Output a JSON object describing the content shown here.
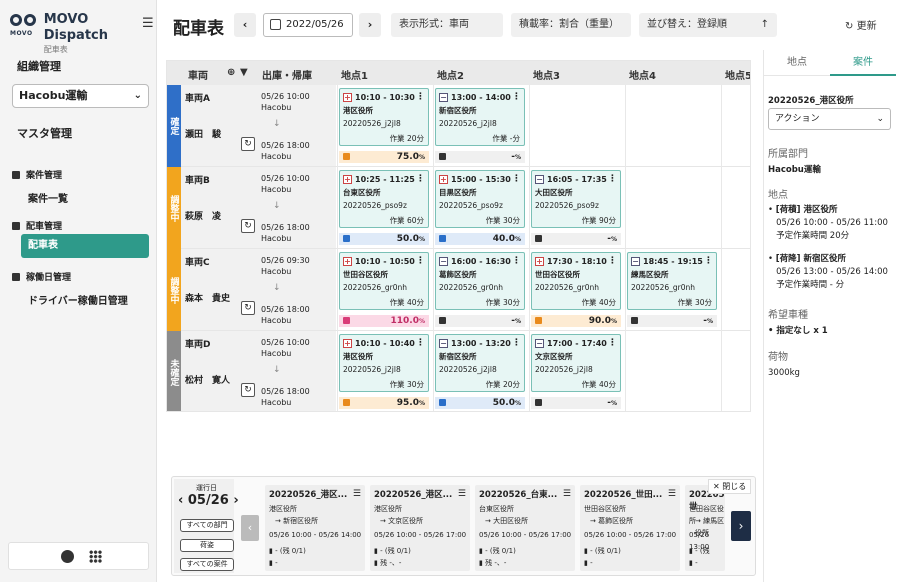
{
  "app": {
    "name": "MOVO Dispatch",
    "subtitle": "配車表",
    "logo_text": "MOVO"
  },
  "sidebar": {
    "org_header": "組織管理",
    "org_select": "Hacobu運輸",
    "master": "マスタ管理",
    "sections": [
      {
        "title": "案件管理",
        "items": [
          "案件一覧"
        ]
      },
      {
        "title": "配車管理",
        "items": [
          "配車表"
        ]
      },
      {
        "title": "稼働日管理",
        "items": [
          "ドライバー稼働日管理"
        ]
      }
    ]
  },
  "toolbar": {
    "title": "配車表",
    "date": "2022/05/26",
    "display": "表示形式：車両",
    "load_rate": "積載率：割合（重量）",
    "sort": "並び替え：登録順",
    "refresh": "更新",
    "prev": "‹",
    "next": "›",
    "sort_arrow": "↑"
  },
  "grid": {
    "headers": {
      "vehicle": "車両",
      "times": "出庫・帰庫",
      "points": [
        "地点1",
        "地点2",
        "地点3",
        "地点4",
        "地点5"
      ]
    },
    "rows": [
      {
        "status": "確定",
        "color": "#2f6fc8",
        "vehicle": "車両A",
        "driver": "瀬田　駿",
        "dep": "05/26 10:00",
        "ret": "05/26 18:00",
        "base": "Hacobu",
        "cards": [
          {
            "type": "pick",
            "time": "10:10 - 10:30",
            "name": "港区役所",
            "id": "20220526_j2jl8",
            "work": "作業 20分"
          },
          {
            "type": "drop",
            "time": "13:00 - 14:00",
            "name": "新宿区役所",
            "id": "20220526_j2jl8",
            "work": "作業 -分"
          }
        ],
        "loads": [
          {
            "value": "75.0",
            "unit": "%",
            "style": "orange"
          },
          {
            "value": "-",
            "unit": "%",
            "style": "grey"
          }
        ]
      },
      {
        "status": "調整中",
        "color": "#f2a51e",
        "vehicle": "車両B",
        "driver": "萩原　凌",
        "dep": "05/26 10:00",
        "ret": "05/26 18:00",
        "base": "Hacobu",
        "cards": [
          {
            "type": "pick",
            "time": "10:25 - 11:25",
            "name": "台東区役所",
            "id": "20220526_pso9z",
            "work": "作業 60分"
          },
          {
            "type": "pick",
            "time": "15:00 - 15:30",
            "name": "目黒区役所",
            "id": "20220526_pso9z",
            "work": "作業 30分"
          },
          {
            "type": "drop",
            "time": "16:05 - 17:35",
            "name": "大田区役所",
            "id": "20220526_pso9z",
            "work": "作業 90分"
          }
        ],
        "loads": [
          {
            "value": "50.0",
            "unit": "%",
            "style": "blue"
          },
          {
            "value": "40.0",
            "unit": "%",
            "style": "blue"
          },
          {
            "value": "-",
            "unit": "%",
            "style": "grey"
          }
        ]
      },
      {
        "status": "調整中",
        "color": "#f2a51e",
        "vehicle": "車両C",
        "driver": "森本　貴史",
        "dep": "05/26 09:30",
        "ret": "05/26 18:00",
        "base": "Hacobu",
        "cards": [
          {
            "type": "pick",
            "time": "10:10 - 10:50",
            "name": "世田谷区役所",
            "id": "20220526_gr0nh",
            "work": "作業 40分"
          },
          {
            "type": "drop",
            "time": "16:00 - 16:30",
            "name": "葛飾区役所",
            "id": "20220526_gr0nh",
            "work": "作業 30分"
          },
          {
            "type": "pick",
            "time": "17:30 - 18:10",
            "name": "世田谷区役所",
            "id": "20220526_gr0nh",
            "work": "作業 40分"
          },
          {
            "type": "drop",
            "time": "18:45 - 19:15",
            "name": "練馬区役所",
            "id": "20220526_gr0nh",
            "work": "作業 30分"
          }
        ],
        "loads": [
          {
            "value": "110.0",
            "unit": "%",
            "style": "pink"
          },
          {
            "value": "-",
            "unit": "%",
            "style": "grey"
          },
          {
            "value": "90.0",
            "unit": "%",
            "style": "orange"
          },
          {
            "value": "-",
            "unit": "%",
            "style": "grey"
          }
        ]
      },
      {
        "status": "未確定",
        "color": "#8c8c8c",
        "vehicle": "車両D",
        "driver": "松村　寛人",
        "dep": "05/26 10:00",
        "ret": "05/26 18:00",
        "base": "Hacobu",
        "cards": [
          {
            "type": "pick",
            "time": "10:10 - 10:40",
            "name": "港区役所",
            "id": "20220526_j2jl8",
            "work": "作業 30分"
          },
          {
            "type": "drop",
            "time": "13:00 - 13:20",
            "name": "新宿区役所",
            "id": "20220526_j2jl8",
            "work": "作業 20分"
          },
          {
            "type": "drop",
            "time": "17:00 - 17:40",
            "name": "文京区役所",
            "id": "20220526_j2jl8",
            "work": "作業 40分"
          }
        ],
        "loads": [
          {
            "value": "95.0",
            "unit": "%",
            "style": "orange"
          },
          {
            "value": "50.0",
            "unit": "%",
            "style": "blue"
          },
          {
            "value": "-",
            "unit": "%",
            "style": "grey"
          }
        ]
      }
    ]
  },
  "bottom": {
    "day_label": "運行日",
    "day_value": "05/26",
    "filters": [
      "すべての部門",
      "荷姿",
      "すべての案件"
    ],
    "close": "閉じる",
    "jobs": [
      {
        "title": "20220526_港区...",
        "from": "港区役所",
        "to": "新宿区役所",
        "time": "05/26 10:00 - 05/26 14:00",
        "vehicle": "- (残 0/1)",
        "cargo": "-"
      },
      {
        "title": "20220526_港区...",
        "from": "港区役所",
        "to": "文京区役所",
        "time": "05/26 10:00 - 05/26 17:00",
        "vehicle": "- (残 0/1)",
        "cargo": "残 -、-"
      },
      {
        "title": "20220526_台東...",
        "from": "台東区役所",
        "to": "大田区役所",
        "time": "05/26 10:00 - 05/26 17:00",
        "vehicle": "- (残 0/1)",
        "cargo": "残 -、-"
      },
      {
        "title": "20220526_世田...",
        "from": "世田谷区役所",
        "to": "葛飾区役所",
        "time": "05/26 10:00 - 05/26 17:00",
        "vehicle": "- (残 0/1)",
        "cargo": "-"
      },
      {
        "title": "20220526_世",
        "from": "世田谷区役所",
        "to": "練馬区役所",
        "time": "05/26 13:00",
        "vehicle": "- (残",
        "cargo": "-"
      }
    ]
  },
  "right": {
    "tabs": [
      "地点",
      "案件"
    ],
    "job_id": "20220526_港区役所",
    "action": "アクション",
    "dept_label": "所属部門",
    "dept": "Hacobu運輸",
    "points_label": "地点",
    "points": [
      {
        "title": "[荷積] 港区役所",
        "time": "05/26 10:00 - 05/26 11:00",
        "work": "予定作業時間 20分"
      },
      {
        "title": "[荷降] 新宿区役所",
        "time": "05/26 13:00 - 05/26 14:00",
        "work": "予定作業時間 - 分"
      }
    ],
    "vehicle_label": "希望車種",
    "vehicle": "指定なし x 1",
    "cargo_label": "荷物",
    "cargo": "3000kg"
  }
}
